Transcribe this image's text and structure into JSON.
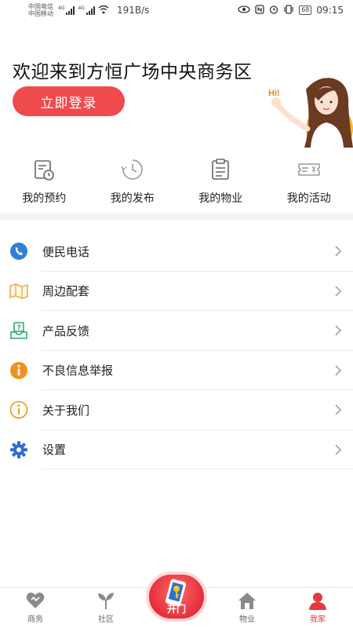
{
  "status_bar": {
    "carrier1": "中国电信",
    "carrier2": "中国移动",
    "net1": "4G",
    "net2": "4G",
    "speed": "191B/s",
    "battery": "68",
    "time": "09:15"
  },
  "header": {
    "welcome": "欢迎来到方恒广场中央商务区",
    "login_label": "立即登录",
    "illustration_text": "Hi!"
  },
  "quick_menu": [
    {
      "label": "我的预约",
      "icon": "calendar-clock-icon"
    },
    {
      "label": "我的发布",
      "icon": "clock-icon"
    },
    {
      "label": "我的物业",
      "icon": "clipboard-icon"
    },
    {
      "label": "我的活动",
      "icon": "ticket-icon"
    }
  ],
  "menu_list": [
    {
      "label": "便民电话",
      "icon": "phone-icon",
      "color": "#2f7fd6"
    },
    {
      "label": "周边配套",
      "icon": "map-icon",
      "color": "#e6b14a"
    },
    {
      "label": "产品反馈",
      "icon": "feedback-icon",
      "color": "#2aa96b"
    },
    {
      "label": "不良信息举报",
      "icon": "report-icon",
      "color": "#f0921e"
    },
    {
      "label": "关于我们",
      "icon": "info-icon",
      "color": "#f0921e"
    },
    {
      "label": "设置",
      "icon": "gear-icon",
      "color": "#2f6fce"
    }
  ],
  "bottom_nav": {
    "items": [
      {
        "label": "商务",
        "icon": "heart-icon"
      },
      {
        "label": "社区",
        "icon": "sprout-icon"
      },
      {
        "label": "物业",
        "icon": "home-icon"
      },
      {
        "label": "我家",
        "icon": "person-icon"
      }
    ],
    "center_label": "开门",
    "active_color": "#e13b3b"
  }
}
